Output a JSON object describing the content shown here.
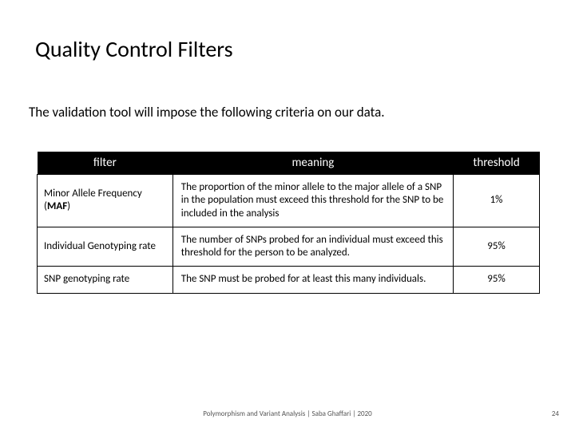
{
  "title": "Quality Control Filters",
  "subtitle": "The validation tool will impose the following criteria on our data.",
  "table": {
    "headers": {
      "filter": "filter",
      "meaning": "meaning",
      "threshold": "threshold"
    },
    "rows": [
      {
        "filter_html": "Minor Allele Frequency (<b>MAF</b>)",
        "meaning": "The proportion of the minor allele to the major allele of a SNP in the population must exceed this threshold for the SNP to be included in the analysis",
        "threshold": "1%"
      },
      {
        "filter_html": "Individual Genotyping rate",
        "meaning": "The number of SNPs probed for an individual must exceed this threshold for the person to be analyzed.",
        "threshold": "95%"
      },
      {
        "filter_html": "SNP genotyping rate",
        "meaning": "The SNP must be probed for at least this many individuals.",
        "threshold": "95%"
      }
    ]
  },
  "footer": "Polymorphism and Variant Analysis | Saba Ghaffari | 2020",
  "page_number": "24",
  "chart_data": {
    "type": "table",
    "columns": [
      "filter",
      "meaning",
      "threshold"
    ],
    "rows": [
      [
        "Minor Allele Frequency (MAF)",
        "The proportion of the minor allele to the major allele of a SNP in the population must exceed this threshold for the SNP to be included in the analysis",
        "1%"
      ],
      [
        "Individual Genotyping rate",
        "The number of SNPs probed for an individual must exceed this threshold for the person to be analyzed.",
        "95%"
      ],
      [
        "SNP genotyping rate",
        "The SNP must be probed for at least this many individuals.",
        "95%"
      ]
    ]
  }
}
